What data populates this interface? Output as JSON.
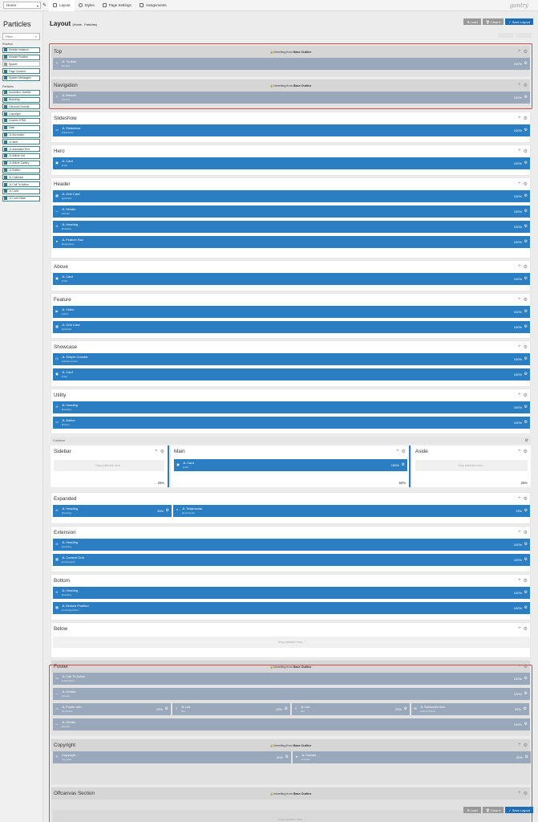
{
  "topbar": {
    "outline": "Home",
    "tabs": [
      {
        "label": "Layout"
      },
      {
        "label": "Styles"
      },
      {
        "label": "Page Settings"
      },
      {
        "label": "Assignments"
      }
    ],
    "logo": "gantry"
  },
  "sidebar": {
    "title": "Particles",
    "filter_placeholder": "Filter...",
    "position_label": "Position",
    "positions": [
      "Module Instance",
      "Module Position",
      "Spacer",
      "Page Content",
      "System Messages"
    ],
    "particles_label": "Particles",
    "particles": [
      "Accordion Joomla",
      "Branding",
      "Carousel Joomla",
      "Copyright",
      "Custom HTML",
      "Date",
      "JL Accordion",
      "JL Alert",
      "JL Animated Text",
      "JL Article List",
      "JL Article Gallery",
      "JL Button",
      "JL Calendar",
      "JL Call To Action",
      "JL Card",
      "JL Card Slider"
    ]
  },
  "header": {
    "title": "Layout",
    "subtitle": "(Home - Particles)",
    "load": "Load",
    "clear": "Clear",
    "save": "Save Layout"
  },
  "inherit_text": "Inheriting from",
  "inherit_from": "Base Outline",
  "drop_text": "Drop particles here...",
  "sections": [
    {
      "title": "Top",
      "inherited": true,
      "rows": [
        [
          {
            "t": "JL Toolbar",
            "s": "jltoolbar",
            "p": "100%",
            "i": "≡"
          }
        ]
      ]
    },
    {
      "title": "Navigation",
      "inherited": true,
      "rows": [
        [
          {
            "t": "JL Navbar",
            "s": "jlnavbar",
            "p": "100%",
            "i": "≡"
          }
        ]
      ]
    },
    {
      "title": "Slideshow",
      "rows": [
        [
          {
            "t": "JL Slideshow",
            "s": "jlslideshow",
            "p": "100%",
            "i": "▭"
          }
        ]
      ]
    },
    {
      "title": "Hero",
      "rows": [
        [
          {
            "t": "JL Card",
            "s": "jlcard",
            "p": "100%",
            "i": "▣"
          }
        ]
      ]
    },
    {
      "title": "Header",
      "rows": [
        [
          {
            "t": "JL Grid Card",
            "s": "jlgridcard",
            "p": "100%",
            "i": "▦"
          }
        ],
        [
          {
            "t": "JL Divider",
            "s": "jldivider",
            "p": "100%",
            "i": "—"
          }
        ],
        [
          {
            "t": "JL Heading",
            "s": "jlheading",
            "p": "100%",
            "i": "H"
          }
        ],
        [
          {
            "t": "JL Feature Box",
            "s": "jlfeaturebox",
            "p": "100%",
            "i": "➤"
          }
        ]
      ]
    },
    {
      "title": "Above",
      "rows": [
        [
          {
            "t": "JL Card",
            "s": "jlcard",
            "p": "100%",
            "i": "▣"
          }
        ]
      ]
    },
    {
      "title": "Feature",
      "rows": [
        [
          {
            "t": "JL Video",
            "s": "jlvideo",
            "p": "100%",
            "i": "▶"
          }
        ],
        [
          {
            "t": "JL Grid Card",
            "s": "jlgridcard",
            "p": "100%",
            "i": "▦"
          }
        ]
      ]
    },
    {
      "title": "Showcase",
      "rows": [
        [
          {
            "t": "JL Simple Counter",
            "s": "jlsimplecounter",
            "p": "100%",
            "i": "◷"
          }
        ],
        [
          {
            "t": "JL Card",
            "s": "jlcard",
            "p": "100%",
            "i": "▣"
          }
        ]
      ]
    },
    {
      "title": "Utility",
      "rows": [
        [
          {
            "t": "JL Heading",
            "s": "jlheading",
            "p": "100%",
            "i": "H"
          }
        ],
        [
          {
            "t": "JL Button",
            "s": "jlbutton",
            "p": "100%",
            "i": "▭"
          }
        ]
      ]
    },
    {
      "title": "Expanded",
      "rows": [
        [
          {
            "t": "JL Heading",
            "s": "jlheading",
            "p": "25%",
            "i": "H"
          },
          {
            "t": "JL Testimonial",
            "s": "jltestimonial",
            "p": "75%",
            "i": "❝"
          }
        ]
      ]
    },
    {
      "title": "Extension",
      "rows": [
        [
          {
            "t": "JL Heading",
            "s": "jlheading",
            "p": "100%",
            "i": "H"
          }
        ],
        [
          {
            "t": "JL Content Grid",
            "s": "jlcontentgrid",
            "p": "100%",
            "i": "▦"
          }
        ]
      ]
    },
    {
      "title": "Bottom",
      "rows": [
        [
          {
            "t": "JL Heading",
            "s": "jlheading",
            "p": "100%",
            "i": "H"
          }
        ],
        [
          {
            "t": "JL Module Position",
            "s": "jlmoduleposition",
            "p": "100%",
            "i": "▦"
          }
        ]
      ]
    },
    {
      "title": "Below",
      "rows": [],
      "empty": true
    },
    {
      "title": "Footer",
      "inherited": true,
      "rows": [
        [
          {
            "t": "JL Call To Action",
            "s": "jlcalltoaction",
            "p": "100%",
            "i": "▭"
          }
        ],
        [
          {
            "t": "JL Divider",
            "s": "jldivider",
            "p": "100%",
            "i": "—"
          }
        ],
        [
          {
            "t": "JL Footer Info",
            "s": "jlfooterinfo",
            "p": "25%",
            "i": "▭"
          },
          {
            "t": "JL List",
            "s": "jllist",
            "p": "25%",
            "i": "≡"
          },
          {
            "t": "JL List",
            "s": "jllist",
            "p": "25%",
            "i": "≡"
          },
          {
            "t": "JL Subscribe Box",
            "s": "jlsubscribebox",
            "p": "25%",
            "i": "✉"
          }
        ],
        [
          {
            "t": "JL Divider",
            "s": "jldivider",
            "p": "100%",
            "i": "—"
          }
        ]
      ]
    },
    {
      "title": "Copyright",
      "inherited": true,
      "rows": [
        [
          {
            "t": "Copyright",
            "s": "copyright",
            "p": "50%",
            "i": "©"
          },
          {
            "t": "JL Socials",
            "s": "jlsocials",
            "p": "50%",
            "i": "♥"
          }
        ]
      ]
    },
    {
      "title": "Offcanvas Section",
      "inherited": true,
      "rows": [],
      "empty": true
    }
  ],
  "container": {
    "label": "Container",
    "cols": [
      {
        "title": "Sidebar",
        "pct": "25%",
        "empty": true
      },
      {
        "title": "Main",
        "pct": "50%",
        "block": {
          "t": "JL Card",
          "s": "jlcard",
          "p": "100%",
          "i": "▣"
        }
      },
      {
        "title": "Aside",
        "pct": "25%",
        "empty": true
      }
    ]
  }
}
